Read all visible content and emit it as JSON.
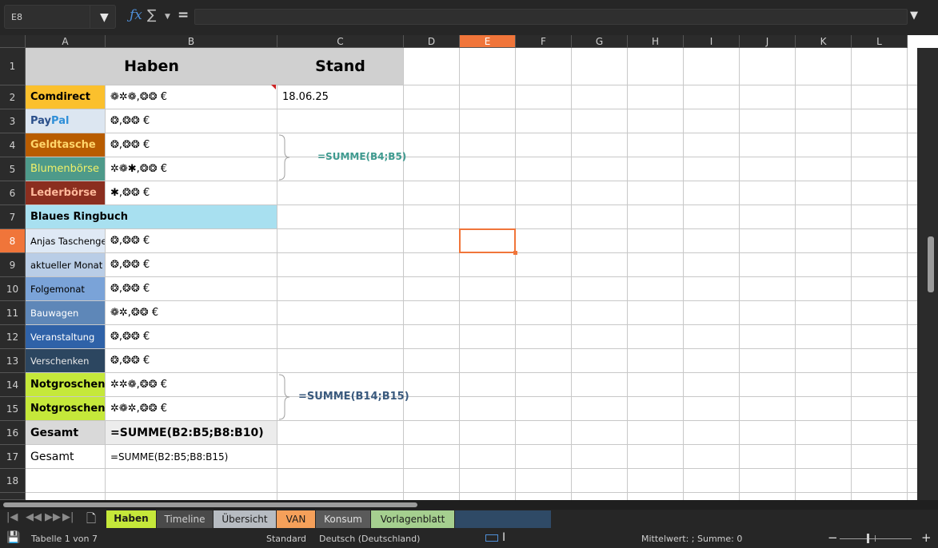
{
  "formula_bar": {
    "name_box": "E8",
    "fx_icon": "ƒx",
    "sum_icon": "∑",
    "equals_icon": "=",
    "formula": ""
  },
  "columns": [
    "A",
    "B",
    "C",
    "D",
    "E",
    "F",
    "G",
    "H",
    "I",
    "J",
    "K",
    "L"
  ],
  "active_column": "E",
  "rows": [
    "1",
    "2",
    "3",
    "4",
    "5",
    "6",
    "7",
    "8",
    "9",
    "10",
    "11",
    "12",
    "13",
    "14",
    "15",
    "16",
    "17",
    "18"
  ],
  "active_row": "8",
  "cells": {
    "B1": "Haben",
    "C1": "Stand",
    "A2": "Comdirect",
    "B2": "❁✲❁,❂❂ €",
    "C2": "18.06.25",
    "A3_pay": "Pay",
    "A3_pal": "Pal",
    "B3": "❂,❂❂ €",
    "A4": "Geldtasche",
    "B4": "❂,❂❂ €",
    "A5": "Blumenbörse",
    "B5": "✲❁✱,❂❂ €",
    "A6": "Lederbörse",
    "B6": "✱,❂❂ €",
    "A7": "Blaues Ringbuch",
    "A8": "Anjas Taschengel",
    "B8": "❂,❂❂ €",
    "A9": "aktueller Monat",
    "B9": "❂,❂❂ €",
    "A10": "Folgemonat",
    "B10": "❂,❂❂ €",
    "A11": "Bauwagen",
    "B11": "❁✲,❂❂ €",
    "A12": "Veranstaltung",
    "B12": "❂,❂❂ €",
    "A13": "Verschenken",
    "B13": "❂,❂❂ €",
    "A14": "Notgroschen I",
    "B14": "✲✲❁,❂❂ €",
    "A15": "Notgroschen I",
    "B15": "✲❁✲,❂❂ €",
    "A16": "Gesamt",
    "B16": "=SUMME(B2:B5;B8:B10)",
    "A17": "Gesamt",
    "B17": "=SUMME(B2:B5;B8:B15)"
  },
  "annotations": {
    "sum_b4_b5": "=SUMME(B4;B5)",
    "sum_b14_b15": "=SUMME(B14;B15)"
  },
  "sheet_tabs": [
    {
      "label": "Haben",
      "active": true
    },
    {
      "label": "Timeline"
    },
    {
      "label": "Übersicht"
    },
    {
      "label": "VAN"
    },
    {
      "label": "Konsum"
    },
    {
      "label": "Vorlagenblatt"
    }
  ],
  "status_bar": {
    "sheet_info": "Tabelle 1 von 7",
    "page_style": "Standard",
    "language": "Deutsch (Deutschland)",
    "summary": "Mittelwert: ; Summe: 0",
    "zoom_minus": "−",
    "zoom_plus": "+"
  },
  "colors": {
    "accent": "#f0753a",
    "header_gray": "#d0d0d0",
    "comdirect": "#fbc02d",
    "paypal": "#dce6f1",
    "geldtasche": "#b85c00",
    "blumenboerse": "#4e9a8a",
    "lederboerse": "#8b2e1f",
    "ringbuch": "#a8e0f0",
    "notgroschen": "#c5e83a"
  }
}
